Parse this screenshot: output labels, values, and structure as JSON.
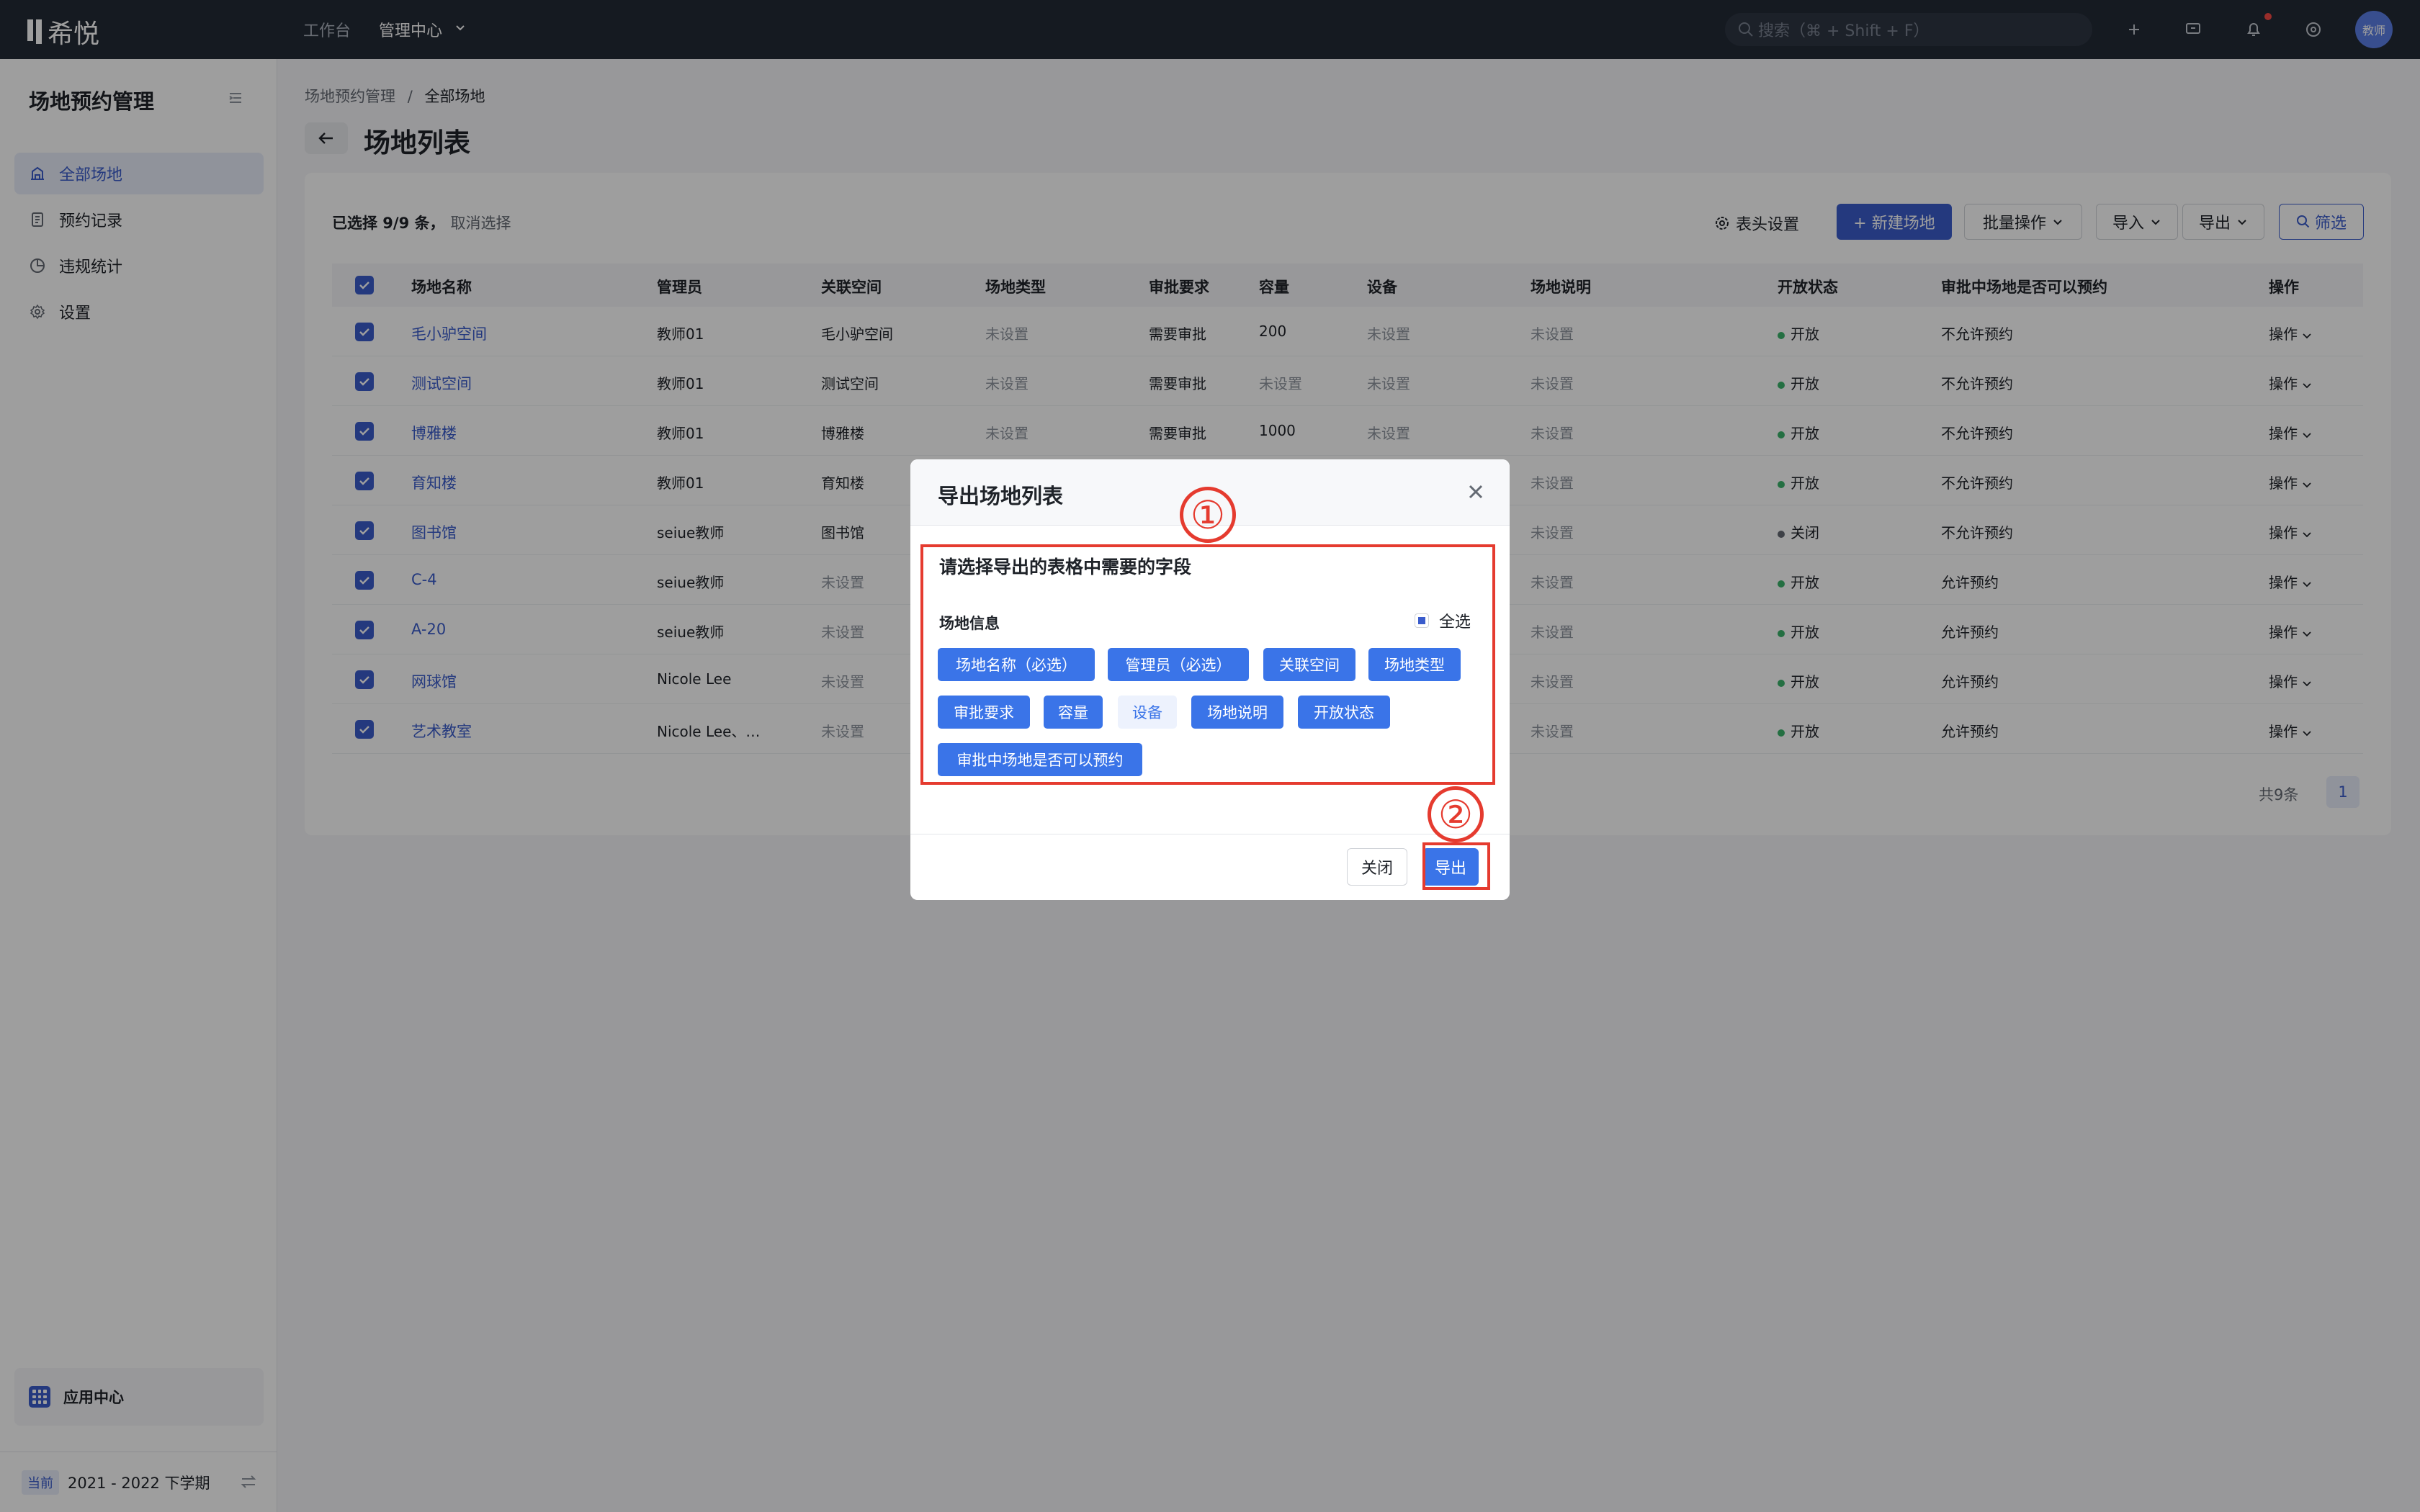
{
  "app": {
    "logo": "希悦",
    "nav": [
      "工作台",
      "管理中心"
    ],
    "search_placeholder": "搜索（⌘ + Shift + F）",
    "avatar": "教师"
  },
  "sidebar": {
    "title": "场地预约管理",
    "items": [
      {
        "label": "全部场地",
        "active": true
      },
      {
        "label": "预约记录"
      },
      {
        "label": "违规统计"
      },
      {
        "label": "设置"
      }
    ],
    "app_center": "应用中心",
    "term_tag": "当前",
    "term": "2021 - 2022 下学期"
  },
  "breadcrumb": {
    "parent": "场地预约管理",
    "sep": "/",
    "current": "全部场地"
  },
  "page_title": "场地列表",
  "toolbar": {
    "selection": "已选择 9/9 条，",
    "cancel": "取消选择",
    "columns": "表头设置",
    "new": "+ 新建场地",
    "batch": "批量操作",
    "import": "导入",
    "export": "导出",
    "filter": "筛选"
  },
  "table": {
    "headers": [
      "场地名称",
      "管理员",
      "关联空间",
      "场地类型",
      "审批要求",
      "容量",
      "设备",
      "场地说明",
      "开放状态",
      "审批中场地是否可以预约",
      "操作"
    ],
    "rows": [
      [
        "毛小驴空间",
        "教师01",
        "毛小驴空间",
        "未设置",
        "需要审批",
        "200",
        "未设置",
        "未设置",
        "开放",
        "不允许预约",
        "操作"
      ],
      [
        "测试空间",
        "教师01",
        "测试空间",
        "未设置",
        "需要审批",
        "未设置",
        "未设置",
        "未设置",
        "开放",
        "不允许预约",
        "操作"
      ],
      [
        "博雅楼",
        "教师01",
        "博雅楼",
        "未设置",
        "需要审批",
        "1000",
        "未设置",
        "未设置",
        "开放",
        "不允许预约",
        "操作"
      ],
      [
        "育知楼",
        "教师01",
        "育知楼",
        "",
        "",
        "",
        "",
        "未设置",
        "开放",
        "不允许预约",
        "操作"
      ],
      [
        "图书馆",
        "seiue教师",
        "图书馆",
        "",
        "",
        "",
        "",
        "未设置",
        "关闭",
        "不允许预约",
        "操作"
      ],
      [
        "C-4",
        "seiue教师",
        "未设置",
        "",
        "",
        "",
        "",
        "未设置",
        "开放",
        "允许预约",
        "操作"
      ],
      [
        "A-20",
        "seiue教师",
        "未设置",
        "",
        "",
        "",
        "",
        "未设置",
        "开放",
        "允许预约",
        "操作"
      ],
      [
        "网球馆",
        "Nicole Lee",
        "未设置",
        "",
        "",
        "",
        "",
        "未设置",
        "开放",
        "允许预约",
        "操作"
      ],
      [
        "艺术教室",
        "Nicole Lee、…",
        "未设置",
        "",
        "",
        "",
        "",
        "未设置",
        "开放",
        "允许预约",
        "操作"
      ]
    ]
  },
  "pager": {
    "total": "共9条",
    "page": "1"
  },
  "modal": {
    "title": "导出场地列表",
    "subtitle": "请选择导出的表格中需要的字段",
    "group": "场地信息",
    "select_all": "全选",
    "fields": [
      {
        "label": "场地名称（必选）",
        "on": true
      },
      {
        "label": "管理员（必选）",
        "on": true
      },
      {
        "label": "关联空间",
        "on": true
      },
      {
        "label": "场地类型",
        "on": true
      },
      {
        "label": "审批要求",
        "on": true
      },
      {
        "label": "容量",
        "on": true
      },
      {
        "label": "设备",
        "on": false
      },
      {
        "label": "场地说明",
        "on": true
      },
      {
        "label": "开放状态",
        "on": true
      },
      {
        "label": "审批中场地是否可以预约",
        "on": true
      }
    ],
    "close": "关闭",
    "export": "导出"
  },
  "annotations": [
    "①",
    "②"
  ],
  "colors": {
    "primary": "#3a5ccc",
    "open": "#3bb36b",
    "closed": "#646a73",
    "annotation": "#e53b2f"
  }
}
